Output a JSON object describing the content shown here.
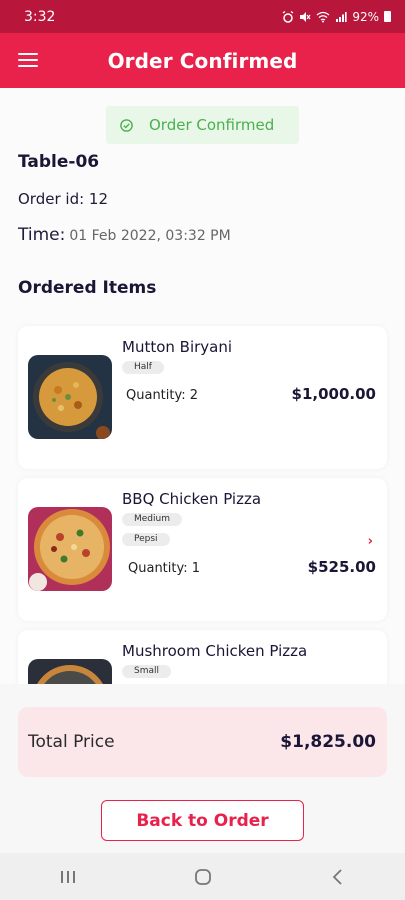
{
  "status_bar": {
    "time": "3:32",
    "icons": [
      "alarm-icon",
      "mute-icon",
      "wifi-icon",
      "signal-icon"
    ],
    "battery": "92%"
  },
  "app_bar": {
    "title": "Order Confirmed",
    "menu_icon": "hamburger-menu-icon"
  },
  "banner": {
    "text": "Order Confirmed",
    "icon": "check-circle-icon",
    "color": "#4caf50"
  },
  "order": {
    "table": "Table-06",
    "order_id": "Order id: 12",
    "time_label": "Time:",
    "time_value": "01 Feb 2022, 03:32 PM"
  },
  "section_title": "Ordered Items",
  "items": [
    {
      "name": "Mutton Biryani",
      "options": [
        "Half"
      ],
      "quantity": "Quantity: 2",
      "price": "$1,000.00"
    },
    {
      "name": "BBQ Chicken Pizza",
      "options": [
        "Medium",
        "Pepsi"
      ],
      "quantity": "Quantity: 1",
      "price": "$525.00",
      "expand_icon": "chevron-right-icon"
    },
    {
      "name": "Mushroom Chicken Pizza",
      "options": [
        "Small"
      ]
    }
  ],
  "total": {
    "label": "Total Price",
    "value": "$1,825.00"
  },
  "back_button": "Back to Order",
  "nav_bar": {
    "icons": [
      "recent-apps-icon",
      "home-icon",
      "back-icon"
    ]
  },
  "colors": {
    "primary": "#e8224b",
    "status_bar": "#b8163a",
    "success": "#4caf50",
    "total_bg": "#fbe6e9"
  }
}
